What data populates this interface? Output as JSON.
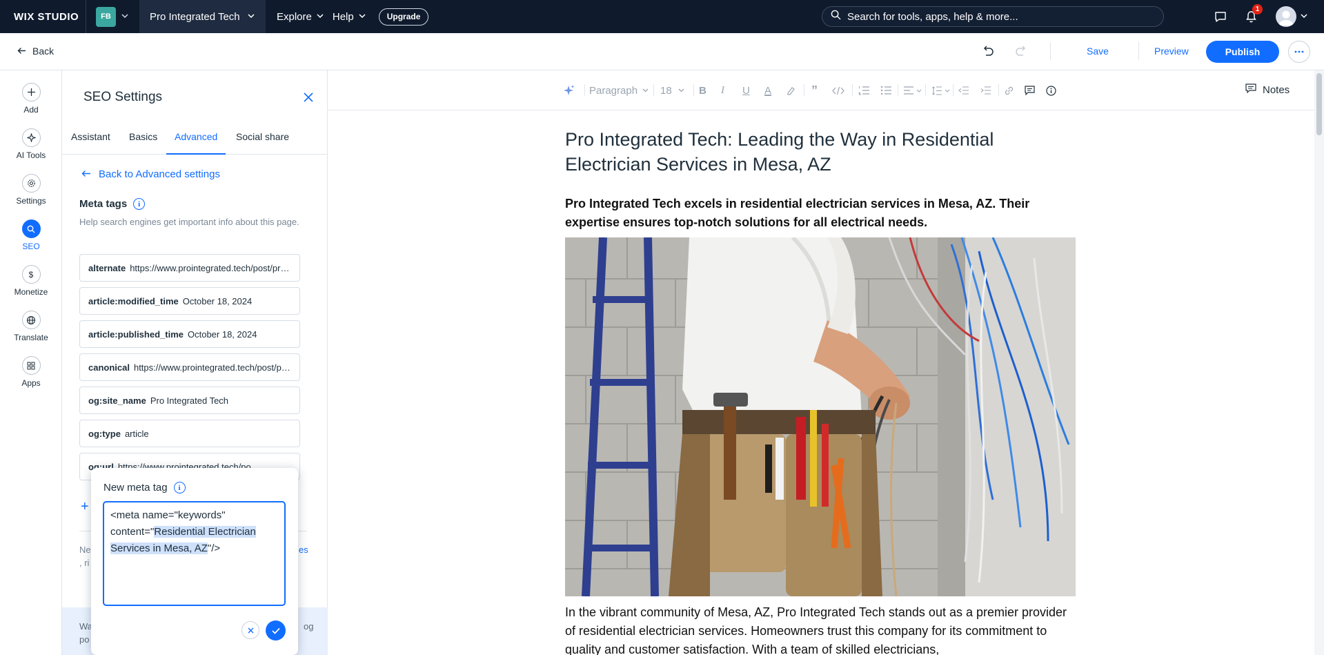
{
  "topbar": {
    "logo": "WIX STUDIO",
    "site_initials": "FB",
    "site_name": "Pro Integrated Tech",
    "menus": [
      "Explore",
      "Help"
    ],
    "upgrade_label": "Upgrade",
    "search_placeholder": "Search for tools, apps, help & more...",
    "notification_count": "1"
  },
  "actionbar": {
    "back_label": "Back",
    "save_label": "Save",
    "preview_label": "Preview",
    "publish_label": "Publish"
  },
  "leftrail": {
    "items": [
      {
        "label": "Add",
        "icon": "plus-icon"
      },
      {
        "label": "AI Tools",
        "icon": "sparkle-icon"
      },
      {
        "label": "Settings",
        "icon": "gear-icon"
      },
      {
        "label": "SEO",
        "icon": "search-icon"
      },
      {
        "label": "Monetize",
        "icon": "dollar-icon"
      },
      {
        "label": "Translate",
        "icon": "globe-icon"
      },
      {
        "label": "Apps",
        "icon": "apps-icon"
      }
    ]
  },
  "panel": {
    "title": "SEO Settings",
    "tabs": [
      "Assistant",
      "Basics",
      "Advanced",
      "Social share"
    ],
    "active_tab": "Advanced",
    "back_label": "Back to Advanced settings",
    "meta_heading": "Meta tags",
    "meta_desc": "Help search engines get important info about this page.",
    "tags": [
      {
        "name": "alternate",
        "value": "https://www.prointegrated.tech/post/pro-integrated-tech"
      },
      {
        "name": "article:modified_time",
        "value": "October 18, 2024"
      },
      {
        "name": "article:published_time",
        "value": "October 18, 2024"
      },
      {
        "name": "canonical",
        "value": "https://www.prointegrated.tech/post/pro-integrated-tech"
      },
      {
        "name": "og:site_name",
        "value": "Pro Integrated Tech"
      },
      {
        "name": "og:type",
        "value": "article"
      },
      {
        "name": "og:url",
        "value": "https://www.prointegrated.tech/po"
      }
    ],
    "fragments": {
      "f1": "Ne",
      "f2": ", ri",
      "f3": "es",
      "f4": "Wa",
      "f5": "po",
      "f6": "og"
    }
  },
  "popup": {
    "title": "New meta tag",
    "code_prefix": "<meta name=\"keywords\" content=\"",
    "code_highlight": "Residential Electrician Services in Mesa, AZ",
    "code_suffix": "\"/>"
  },
  "editor": {
    "toolbar": {
      "style": "Paragraph",
      "font_size": "18",
      "notes_label": "Notes"
    },
    "doc": {
      "title": "Pro Integrated Tech: Leading the Way in Residential Electrician Services in Mesa, AZ",
      "lead": "Pro Integrated Tech excels in residential electrician services in Mesa, AZ. Their expertise ensures top-notch solutions for all electrical needs.",
      "body": "In the vibrant community of Mesa, AZ, Pro Integrated Tech stands out as a premier provider of residential electrician services. Homeowners trust this company for its commitment to quality and customer satisfaction. With a team of skilled electricians,"
    }
  },
  "colors": {
    "accent": "#116dff",
    "topbar": "#0f1b2d",
    "text": "#20303c"
  }
}
